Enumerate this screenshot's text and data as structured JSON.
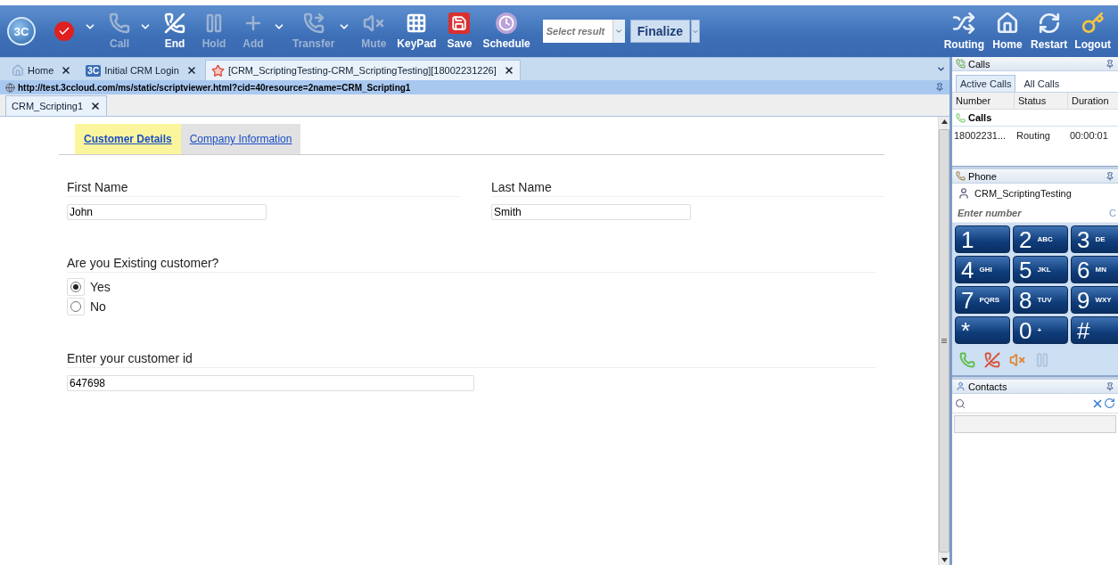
{
  "toolbar": {
    "logo": "3C",
    "buttons": [
      {
        "kind": "status",
        "caret": true
      },
      {
        "kind": "call",
        "label": "Call",
        "disabled": true,
        "caret": true
      },
      {
        "kind": "end",
        "label": "End",
        "disabled": false,
        "caret": false
      },
      {
        "kind": "hold",
        "label": "Hold",
        "disabled": true,
        "caret": false
      },
      {
        "kind": "add",
        "label": "Add",
        "disabled": true,
        "caret": true
      },
      {
        "kind": "transfer",
        "label": "Transfer",
        "disabled": true,
        "caret": true
      },
      {
        "kind": "mute",
        "label": "Mute",
        "disabled": true,
        "caret": false
      },
      {
        "kind": "keypad",
        "label": "KeyPad",
        "disabled": false,
        "caret": false
      },
      {
        "kind": "save",
        "label": "Save",
        "disabled": false,
        "caret": false
      },
      {
        "kind": "schedule",
        "label": "Schedule",
        "disabled": false,
        "caret": false
      }
    ],
    "result_select": {
      "placeholder": "Select result"
    },
    "finalize": "Finalize",
    "right_buttons": [
      {
        "kind": "routing",
        "label": "Routing"
      },
      {
        "kind": "home",
        "label": "Home"
      },
      {
        "kind": "restart",
        "label": "Restart"
      },
      {
        "kind": "logout",
        "label": "Logout"
      }
    ]
  },
  "tabs": [
    {
      "kind": "home",
      "label": "Home",
      "selected": false
    },
    {
      "kind": "logo",
      "logo": "3C",
      "label": "Initial CRM Login",
      "selected": false
    },
    {
      "kind": "script",
      "label": "[CRM_ScriptingTesting-CRM_ScriptingTesting][18002231226]",
      "selected": true
    }
  ],
  "address": "http://test.3ccloud.com/ms/static/scriptviewer.html?cid=40resource=2name=CRM_Scripting1",
  "doc_tabs": [
    {
      "label": "CRM_Scripting1",
      "selected": true
    }
  ],
  "script": {
    "tabs": [
      {
        "label": "Customer Details",
        "selected": true
      },
      {
        "label": "Company Information",
        "selected": false
      }
    ],
    "name_fields": [
      {
        "label": "First Name",
        "value": "John"
      },
      {
        "label": "Last Name",
        "value": "Smith"
      }
    ],
    "question": {
      "label": "Are you Existing customer?",
      "options": [
        {
          "label": "Yes",
          "selected": true
        },
        {
          "label": "No",
          "selected": false
        }
      ]
    },
    "customer_id": {
      "label": "Enter your customer id",
      "value": "647698"
    }
  },
  "calls": {
    "title": "Calls",
    "tabs": [
      {
        "label": "Active Calls",
        "selected": true
      },
      {
        "label": "All Calls",
        "selected": false
      }
    ],
    "columns": [
      "Number",
      "Status",
      "Duration"
    ],
    "group": "Calls",
    "rows": [
      {
        "number": "18002231...",
        "status": "Routing",
        "duration": "00:00:01"
      }
    ]
  },
  "phone": {
    "title": "Phone",
    "profile": "CRM_ScriptingTesting",
    "number": {
      "placeholder": "Enter number"
    },
    "clear": "C",
    "keys": [
      {
        "digit": "1"
      },
      {
        "digit": "2",
        "letters": "ABC"
      },
      {
        "digit": "3",
        "letters": "DE"
      },
      {
        "digit": "4",
        "letters": "GHI"
      },
      {
        "digit": "5",
        "letters": "JKL"
      },
      {
        "digit": "6",
        "letters": "MN"
      },
      {
        "digit": "7",
        "letters": "PQRS"
      },
      {
        "digit": "8",
        "letters": "TUV"
      },
      {
        "digit": "9",
        "letters": "WXY"
      },
      {
        "digit": "*"
      },
      {
        "digit": "0",
        "letters": "+"
      },
      {
        "digit": "#"
      }
    ],
    "actions": [
      {
        "kind": "call",
        "disabled": false
      },
      {
        "kind": "hangup",
        "disabled": false
      },
      {
        "kind": "mute",
        "disabled": false
      },
      {
        "kind": "hold",
        "disabled": true
      }
    ]
  },
  "contacts": {
    "title": "Contacts"
  }
}
